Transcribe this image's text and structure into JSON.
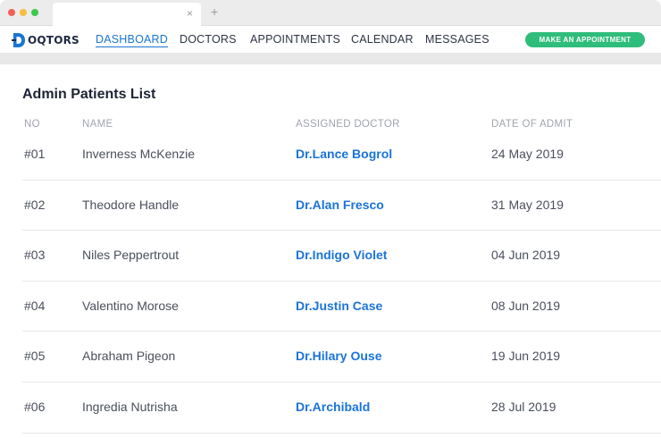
{
  "browser": {
    "close_glyph": "×",
    "new_tab_glyph": "+"
  },
  "brand": {
    "logo_text": "OQTORS",
    "logo_mark_letter": "D"
  },
  "nav": {
    "items": [
      {
        "label": "DASHBOARD",
        "active": true
      },
      {
        "label": "DOCTORS",
        "active": false
      },
      {
        "label": "APPOINTMENTS",
        "active": false
      },
      {
        "label": "CALENDAR",
        "active": false
      },
      {
        "label": "MESSAGES",
        "active": false
      }
    ],
    "cta_label": "MAKE AN APPOINTMENT"
  },
  "page": {
    "title": "Admin Patients List"
  },
  "table": {
    "headers": {
      "no": "NO",
      "name": "NAME",
      "doctor": "ASSIGNED DOCTOR",
      "date": "DATE OF ADMIT"
    },
    "rows": [
      {
        "no": "#01",
        "name": "Inverness McKenzie",
        "doctor": "Dr.Lance Bogrol",
        "date": "24 May 2019"
      },
      {
        "no": "#02",
        "name": "Theodore Handle",
        "doctor": "Dr.Alan Fresco",
        "date": "31 May 2019"
      },
      {
        "no": "#03",
        "name": "Niles Peppertrout",
        "doctor": "Dr.Indigo Violet",
        "date": "04 Jun 2019"
      },
      {
        "no": "#04",
        "name": "Valentino Morose",
        "doctor": "Dr.Justin Case",
        "date": "08 Jun 2019"
      },
      {
        "no": "#05",
        "name": "Abraham Pigeon",
        "doctor": "Dr.Hilary Ouse",
        "date": "19 Jun 2019"
      },
      {
        "no": "#06",
        "name": "Ingredia Nutrisha",
        "doctor": "Dr.Archibald",
        "date": "28 Jul 2019"
      }
    ]
  },
  "colors": {
    "accent": "#1976d2",
    "doctor_link": "#1a73d9",
    "cta": "#2ebd7a"
  }
}
